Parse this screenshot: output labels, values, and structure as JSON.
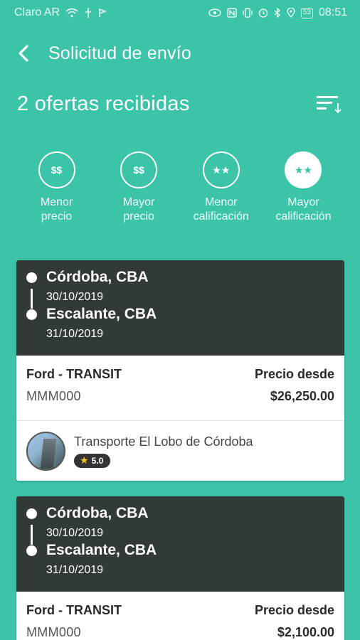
{
  "status_bar": {
    "carrier": "Claro AR",
    "battery": "53",
    "time": "08:51",
    "icons": [
      "wifi-icon",
      "usb-icon",
      "flag-icon",
      "eye-icon",
      "nfc-icon",
      "vibrate-icon",
      "bluetooth-icon",
      "alarm-icon",
      "location-icon",
      "battery-icon"
    ]
  },
  "header": {
    "title": "Solicitud de envío"
  },
  "offers": {
    "count_label": "2 ofertas recibidas"
  },
  "filters": [
    {
      "label_1": "Menor",
      "label_2": "precio",
      "icon": "$$",
      "active": false
    },
    {
      "label_1": "Mayor",
      "label_2": "precio",
      "icon": "$$",
      "active": false
    },
    {
      "label_1": "Menor",
      "label_2": "calificación",
      "icon": "★★",
      "active": false
    },
    {
      "label_1": "Mayor",
      "label_2": "calificación",
      "icon": "★★",
      "active": true
    }
  ],
  "cards": [
    {
      "origin_city": "Córdoba, CBA",
      "origin_date": "30/10/2019",
      "dest_city": "Escalante, CBA",
      "dest_date": "31/10/2019",
      "vehicle": "Ford - TRANSIT",
      "plate": "MMM000",
      "price_label": "Precio desde",
      "price": "$26,250.00",
      "carrier_name": "Transporte El Lobo de Córdoba",
      "rating": "5.0"
    },
    {
      "origin_city": "Córdoba, CBA",
      "origin_date": "30/10/2019",
      "dest_city": "Escalante, CBA",
      "dest_date": "31/10/2019",
      "vehicle": "Ford - TRANSIT",
      "plate": "MMM000",
      "price_label": "Precio desde",
      "price": "$2,100.00"
    }
  ],
  "colors": {
    "background": "#3cc4a8",
    "route_bg": "#323a37",
    "card_bg": "#ffffff",
    "star": "#f5c518"
  }
}
